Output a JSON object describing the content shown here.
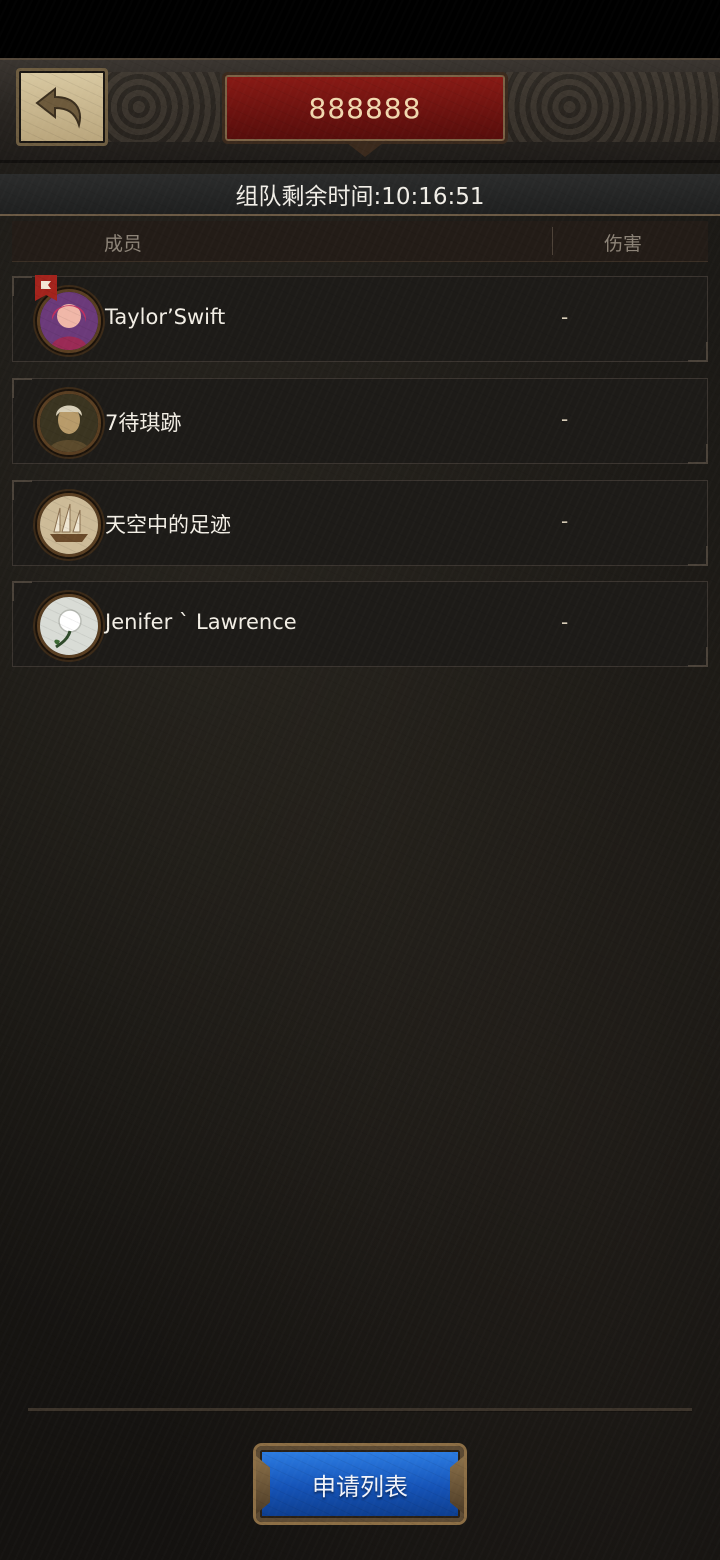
{
  "header": {
    "title": "888888",
    "back_icon": "back-arrow-icon"
  },
  "timer": {
    "label": "组队剩余时间:10:16:51"
  },
  "table": {
    "columns": [
      "成员",
      "伤害"
    ]
  },
  "members": [
    {
      "name": "Taylor’Swift",
      "damage": "-",
      "avatar": "woman-portrait-avatar",
      "leader": true
    },
    {
      "name": "7待琪跡",
      "damage": "-",
      "avatar": "warrior-portrait-avatar",
      "leader": false
    },
    {
      "name": "天空中的足迹",
      "damage": "-",
      "avatar": "sailing-ship-avatar",
      "leader": false
    },
    {
      "name": "Jenifer ` Lawrence",
      "damage": "-",
      "avatar": "white-rose-avatar",
      "leader": false
    }
  ],
  "footer": {
    "apply_list_label": "申请列表"
  },
  "colors": {
    "title_plaque": "#6b120f",
    "button_blue": "#1553b7",
    "background": "#1a1814"
  }
}
